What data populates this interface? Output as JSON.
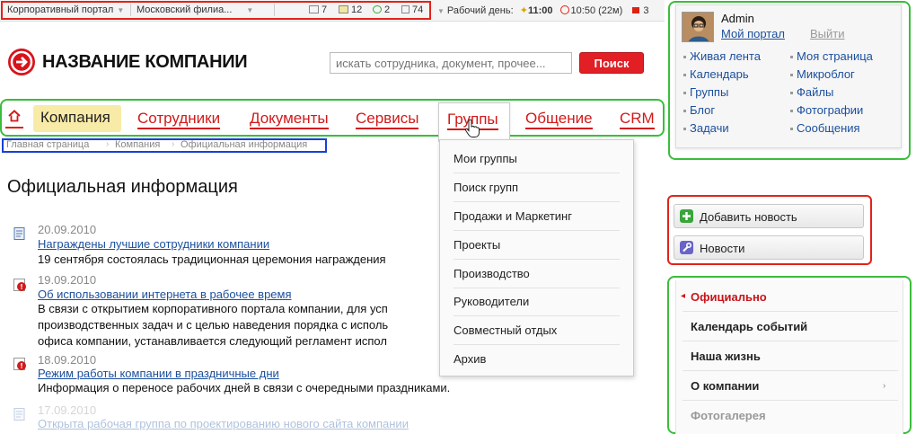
{
  "topbar": {
    "portal": "Корпоративный портал",
    "branch": "Московский филиа...",
    "mail_count": "7",
    "tasks_count": "12",
    "events_count": "2",
    "docs_count": "74",
    "workday_label": "Рабочий день:",
    "workday_start": "11:00",
    "workday_elapsed": "10:50",
    "workday_duration": "(22м)",
    "flag_count": "3"
  },
  "logo": {
    "text": "НАЗВАНИЕ КОМПАНИИ"
  },
  "search": {
    "placeholder": "искать сотрудника, документ, прочее...",
    "button": "Поиск"
  },
  "nav": {
    "items": [
      "Компания",
      "Сотрудники",
      "Документы",
      "Сервисы",
      "Группы",
      "Общение",
      "CRM"
    ]
  },
  "breadcrumb": [
    "Главная страница",
    "Компания",
    "Официальная информация"
  ],
  "page_title": "Официальная информация",
  "news": [
    {
      "date": "20.09.2010",
      "title": "Награждены лучшие сотрудники компании",
      "text": [
        "19 сентября состоялась традиционная церемония награждения"
      ]
    },
    {
      "date": "19.09.2010",
      "title": "Об использовании интернета в рабочее время",
      "text": [
        "В связи с открытием корпоративного портала компании, для усп",
        "производственных задач и с целью наведения порядка с исполь",
        "офиса компании, устанавливается следующий регламент испол"
      ]
    },
    {
      "date": "18.09.2010",
      "title": "Режим работы компании в праздничные дни",
      "text": [
        "Информация о переносе рабочих дней в связи с очередными праздниками."
      ]
    },
    {
      "date": "17.09.2010",
      "title": "Открыта рабочая группа по проектированию нового сайта компании",
      "text": []
    }
  ],
  "groups_menu": [
    "Мои группы",
    "Поиск групп",
    "Продажи и Маркетинг",
    "Проекты",
    "Производство",
    "Руководители",
    "Совместный отдых",
    "Архив"
  ],
  "user": {
    "name": "Admin",
    "portal_link": "Мой портал",
    "logout": "Выйти",
    "links_left": [
      "Живая лента",
      "Календарь",
      "Группы",
      "Блог",
      "Задачи"
    ],
    "links_right": [
      "Моя страница",
      "Микроблог",
      "Файлы",
      "Фотографии",
      "Сообщения"
    ]
  },
  "actions": {
    "add_news": "Добавить новость",
    "news": "Новости"
  },
  "side_menu": [
    "Официально",
    "Календарь событий",
    "Наша жизнь",
    "О компании",
    "Фотогалерея"
  ],
  "colors": {
    "accent_red": "#d21a1a",
    "frame_green": "#3bbd3b",
    "frame_blue": "#1a3fd6",
    "link_blue": "#1b4f9c",
    "active_tab": "#f8eba8"
  }
}
